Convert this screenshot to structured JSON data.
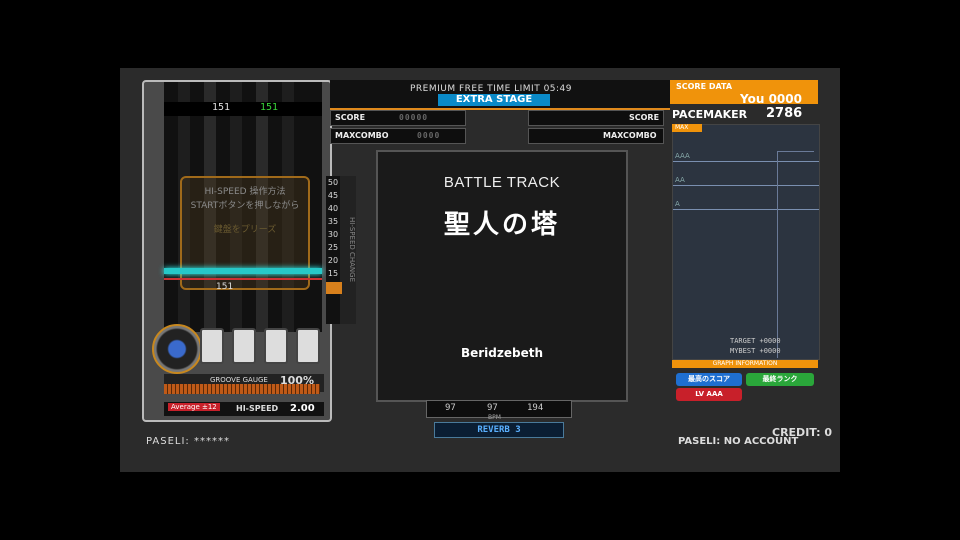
{
  "header": {
    "premium_free": "PREMIUM FREE TIME LIMIT 05:49",
    "stage": "EXTRA STAGE"
  },
  "left_panel": {
    "bpm_left": "151",
    "bpm_right": "151",
    "hispeed_title": "HI-SPEED 操作方法",
    "hispeed_line1": "STARTボタンを押しながら",
    "hispeed_line2": "鍵盤をプリーズ",
    "bottom_bpm": "151",
    "number_column": [
      "50",
      "45",
      "40",
      "35",
      "30",
      "25",
      "20",
      "15",
      "10"
    ],
    "vertical_label": "HI-SPEED CHANGE",
    "groove_gauge_label": "GROOVE GAUGE",
    "groove_gauge_value": "100%",
    "groove_gauge_percent": 100,
    "option_badge": "Average ±12",
    "hispeed_label": "HI-SPEED",
    "hispeed_value": "2.00",
    "paseli": "PASELI: ******"
  },
  "scores": {
    "p1_score_label": "SCORE",
    "p1_maxcombo_label": "MAXCOMBO",
    "p1_score_digits": "00000",
    "p1_combo_digits": "0000",
    "p2_score_label": "SCORE",
    "p2_maxcombo_label": "MAXCOMBO"
  },
  "center": {
    "battle": "BATTLE TRACK",
    "title": "聖人の塔",
    "artist": "Beridzebeth",
    "bpm_min": "97",
    "bpm_now": "97",
    "bpm_max": "194",
    "bpm_label": "BPM",
    "effect": "REVERB 3"
  },
  "right_panel": {
    "score_data_label": "SCORE DATA",
    "you_label": "You",
    "you_score": "0000",
    "pacemaker_label": "PACEMAKER",
    "pacemaker_value": "2786",
    "grade_tab": "MAX",
    "grades": [
      "AAA",
      "AA",
      "A"
    ],
    "target_line": "TARGET +0000",
    "mybest_line": "MYBEST +0000",
    "graph_info": "GRAPH INFORMATION",
    "btn1": "最高のスコア",
    "btn2": "最終ランク",
    "btn3": "LV AAA",
    "credit": "CREDIT: 0",
    "paseli": "PASELI: NO ACCOUNT"
  },
  "colors": {
    "accent": "#f0930b",
    "stage_blue": "#0a8ac8",
    "judge_cyan": "#27c8c8",
    "btn_blue": "#1f6fd0",
    "btn_green": "#2aa63a",
    "btn_red": "#c8202a"
  }
}
